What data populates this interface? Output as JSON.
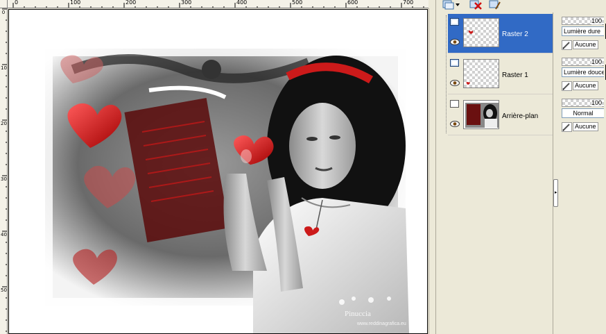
{
  "rulers": {
    "top_labels": [
      "0",
      "100",
      "200",
      "300",
      "400",
      "500",
      "600",
      "700"
    ],
    "left_labels": [
      "0",
      "100",
      "200",
      "300",
      "400",
      "500"
    ]
  },
  "document": {
    "watermark_title": "Pinuccia",
    "watermark_url": "www.reddinagrafica.eu"
  },
  "layers_toolbar": {
    "icons": [
      "new-layer-icon",
      "dropdown-arrow-icon",
      "delete-layer-icon",
      "layer-properties-icon"
    ]
  },
  "layers": [
    {
      "name": "Raster 2",
      "selected": true,
      "opacity": "100",
      "blend": "Lumière dure",
      "mask": "Aucune"
    },
    {
      "name": "Raster 1",
      "selected": false,
      "opacity": "100",
      "blend": "Lumière douce",
      "mask": "Aucune"
    },
    {
      "name": "Arrière-plan",
      "selected": false,
      "opacity": "100",
      "blend": "Normal",
      "mask": "Aucune"
    }
  ],
  "colors": {
    "selection": "#316ac5",
    "panel_bg": "#ece9d8",
    "accent_red": "#cc1a1a"
  }
}
